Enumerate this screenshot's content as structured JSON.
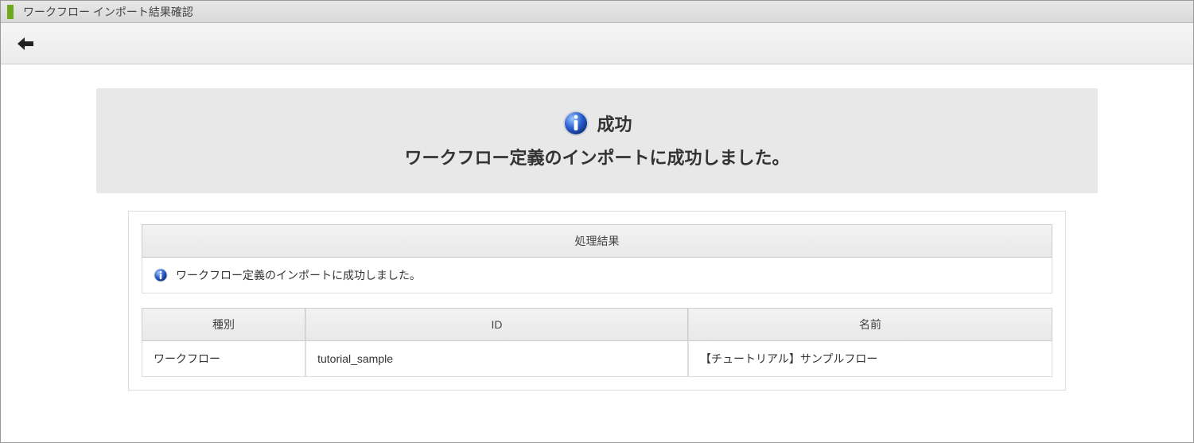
{
  "title": "ワークフロー インポート結果確認",
  "banner": {
    "status": "成功",
    "message": "ワークフロー定義のインポートに成功しました。"
  },
  "result_table": {
    "header": "処理結果",
    "message": "ワークフロー定義のインポートに成功しました。"
  },
  "detail_table": {
    "headers": {
      "type": "種別",
      "id": "ID",
      "name": "名前"
    },
    "row": {
      "type": "ワークフロー",
      "id": "tutorial_sample",
      "name": "【チュートリアル】サンプルフロー"
    }
  }
}
